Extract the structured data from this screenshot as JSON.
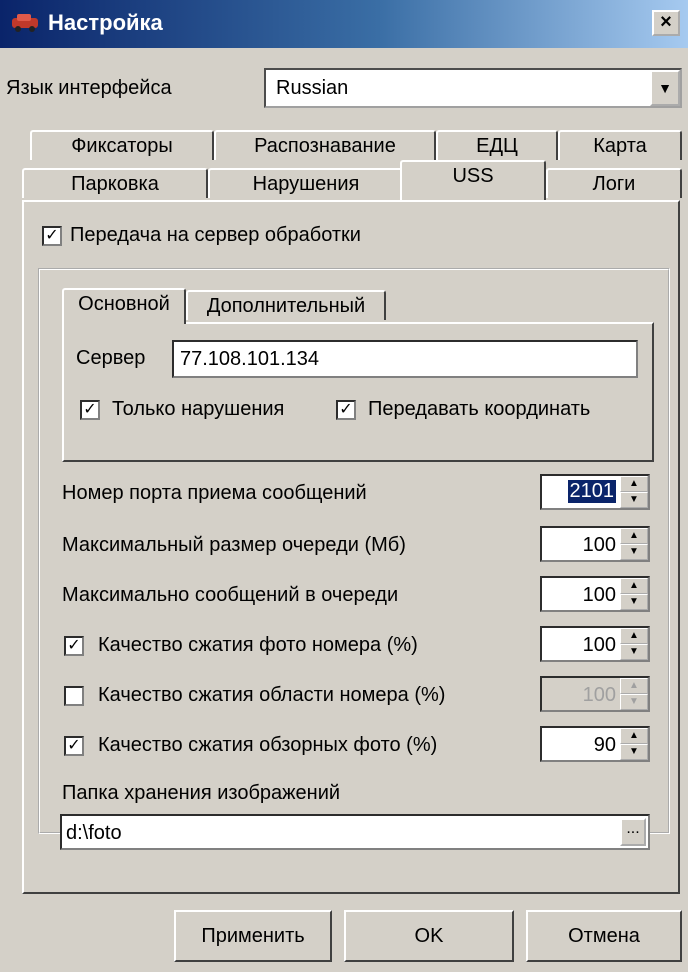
{
  "window": {
    "title": "Настройка",
    "close_label": "×"
  },
  "language": {
    "label": "Язык интерфейса",
    "value": "Russian"
  },
  "tabs_row1": [
    "Фиксаторы",
    "Распознавание",
    "ЕДЦ",
    "Карта"
  ],
  "tabs_row2": [
    "Парковка",
    "Нарушения",
    "USS",
    "Логи"
  ],
  "active_tab": "USS",
  "uss": {
    "send_to_server": {
      "label": "Передача на сервер обработки",
      "checked": true
    },
    "subtabs": [
      "Основной",
      "Дополнительный"
    ],
    "server_label": "Сервер",
    "server_value": "77.108.101.134",
    "only_violations": {
      "label": "Только нарушения",
      "checked": true
    },
    "send_coords": {
      "label": "Передавать координать",
      "checked": true
    },
    "port": {
      "label": "Номер порта приема сообщений",
      "value": "2101"
    },
    "max_queue_size": {
      "label": "Максимальный размер очереди (Мб)",
      "value": "100"
    },
    "max_queue_msgs": {
      "label": "Максимально сообщений в очереди",
      "value": "100"
    },
    "q_plate_photo": {
      "label": "Качество сжатия фото номера (%)",
      "value": "100",
      "checked": true
    },
    "q_plate_area": {
      "label": "Качество сжатия области номера (%)",
      "value": "100",
      "checked": false
    },
    "q_overview": {
      "label": "Качество сжатия обзорных фото (%)",
      "value": "90",
      "checked": true
    },
    "folder_label": "Папка хранения изображений",
    "folder_value": "d:\\foto",
    "browse_label": "..."
  },
  "buttons": {
    "apply": "Применить",
    "ok": "OK",
    "cancel": "Отмена"
  },
  "icons": {
    "window": "car-icon",
    "close": "close-icon",
    "dropdown": "chevron-down-icon"
  },
  "colors": {
    "titlebar": "#0a246a",
    "highlight": "#0a246a",
    "face": "#d4d0c8"
  }
}
